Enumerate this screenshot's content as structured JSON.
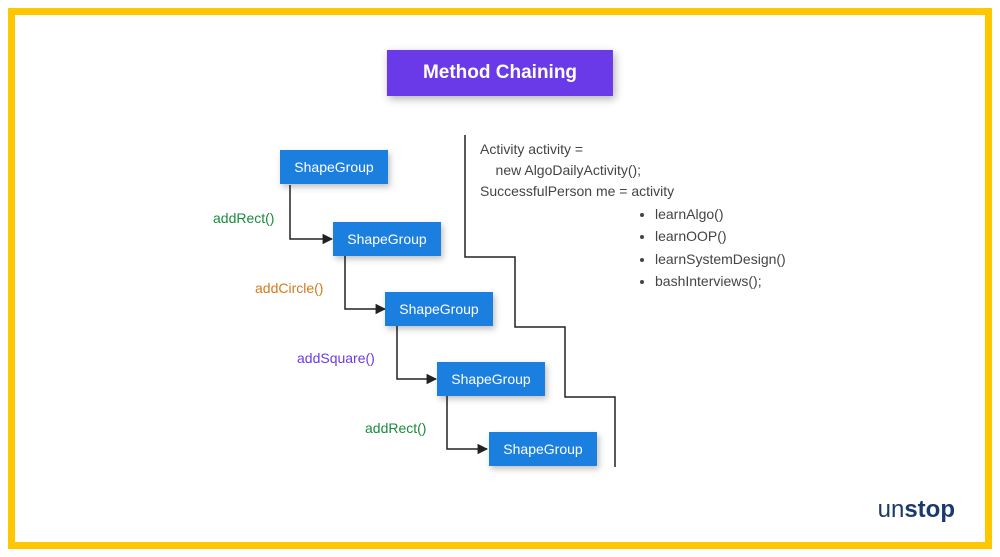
{
  "title": "Method Chaining",
  "shapes": {
    "s1": "ShapeGroup",
    "s2": "ShapeGroup",
    "s3": "ShapeGroup",
    "s4": "ShapeGroup",
    "s5": "ShapeGroup"
  },
  "methods": {
    "m1": "addRect()",
    "m2": "addCircle()",
    "m3": "addSquare()",
    "m4": "addRect()"
  },
  "colors": {
    "m1": "#1a8a3e",
    "m2": "#d17a1a",
    "m3": "#6a3ae8",
    "m4": "#1a8a3e"
  },
  "code": {
    "line1": "Activity activity =",
    "line2": "    new AlgoDailyActivity();",
    "line3": "SuccessfulPerson me = activity",
    "bullets": [
      "learnAlgo()",
      "learnOOP()",
      "learnSystemDesign()",
      "bashInterviews();"
    ]
  },
  "logo": {
    "part1": "un",
    "part2": "stop"
  }
}
